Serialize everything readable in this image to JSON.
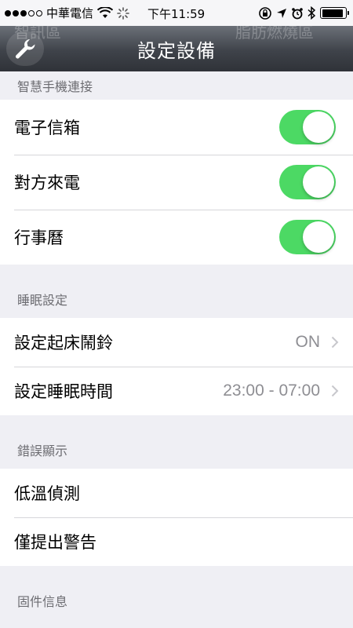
{
  "status_bar": {
    "carrier": "中華電信",
    "time": "下午11:59"
  },
  "nav": {
    "title": "設定設備",
    "ghost_left": "智訊區",
    "ghost_right": "脂肪燃燒區"
  },
  "sections": {
    "phone_connection": {
      "header": "智慧手機連接",
      "items": [
        {
          "label": "電子信箱",
          "on": true
        },
        {
          "label": "對方來電",
          "on": true
        },
        {
          "label": "行事曆",
          "on": true
        }
      ]
    },
    "sleep": {
      "header": "睡眠設定",
      "items": [
        {
          "label": "設定起床鬧鈴",
          "value": "ON"
        },
        {
          "label": "設定睡眠時間",
          "value": "23:00 - 07:00"
        }
      ]
    },
    "errors": {
      "header": "錯誤顯示",
      "items": [
        {
          "label": "低溫偵測"
        },
        {
          "label": "僅提出警告"
        }
      ]
    },
    "firmware": {
      "header": "固件信息"
    }
  },
  "colors": {
    "toggle_on": "#4cd964",
    "nav_bar": "#3f434a",
    "background": "#efeff4"
  }
}
